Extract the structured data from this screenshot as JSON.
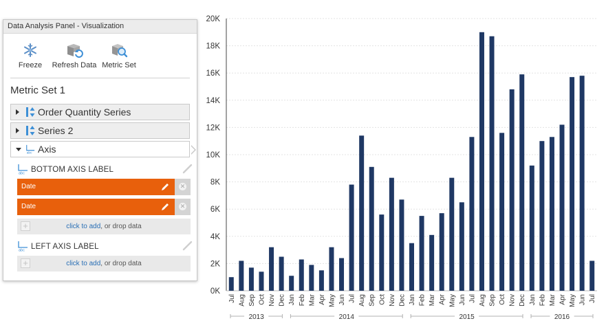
{
  "panel": {
    "title": "Data Analysis Panel - Visualization",
    "toolbar": [
      {
        "label": "Freeze",
        "icon": "snowflake-icon"
      },
      {
        "label": "Refresh Data",
        "icon": "refresh-data-icon"
      },
      {
        "label": "Metric Set",
        "icon": "metric-set-icon"
      }
    ],
    "metric_set_title": "Metric Set 1",
    "series": [
      {
        "label": "Order Quantity Series",
        "expanded": false
      },
      {
        "label": "Series 2",
        "expanded": false
      },
      {
        "label": "Axis",
        "expanded": true
      }
    ],
    "bottom_axis": {
      "heading": "BOTTOM AXIS LABEL",
      "items": [
        "Date",
        "Date"
      ]
    },
    "left_axis": {
      "heading": "LEFT AXIS LABEL"
    },
    "drop_zone": {
      "link": "click to add",
      "rest": ", or drop data"
    },
    "accent_color": "#e8600c"
  },
  "chart_data": {
    "type": "bar",
    "bar_color": "#1f3864",
    "ylim": [
      0,
      20000
    ],
    "y_ticks": [
      "0K",
      "2K",
      "4K",
      "6K",
      "8K",
      "10K",
      "12K",
      "14K",
      "16K",
      "18K",
      "20K"
    ],
    "categories": [
      "Jul",
      "Aug",
      "Sep",
      "Oct",
      "Nov",
      "Dec",
      "Jan",
      "Feb",
      "Mar",
      "Apr",
      "May",
      "Jun",
      "Jul",
      "Aug",
      "Sep",
      "Oct",
      "Nov",
      "Dec",
      "Jan",
      "Feb",
      "Mar",
      "Apr",
      "May",
      "Jun",
      "Jul",
      "Aug",
      "Sep",
      "Oct",
      "Nov",
      "Dec",
      "Jan",
      "Feb",
      "Mar",
      "Apr",
      "May",
      "Jun",
      "Jul"
    ],
    "values": [
      1000,
      2200,
      1700,
      1400,
      3200,
      2500,
      1100,
      2300,
      1900,
      1500,
      3200,
      2400,
      7800,
      11400,
      9100,
      5600,
      8300,
      6700,
      3500,
      5500,
      4100,
      5700,
      8300,
      6500,
      11300,
      19000,
      18700,
      11600,
      14800,
      15900,
      9200,
      11000,
      11300,
      12200,
      15700,
      15800,
      2200
    ],
    "year_groups": [
      {
        "label": "2013",
        "count": 6
      },
      {
        "label": "2014",
        "count": 12
      },
      {
        "label": "2015",
        "count": 12
      },
      {
        "label": "2016",
        "count": 7
      }
    ],
    "grid": true
  }
}
